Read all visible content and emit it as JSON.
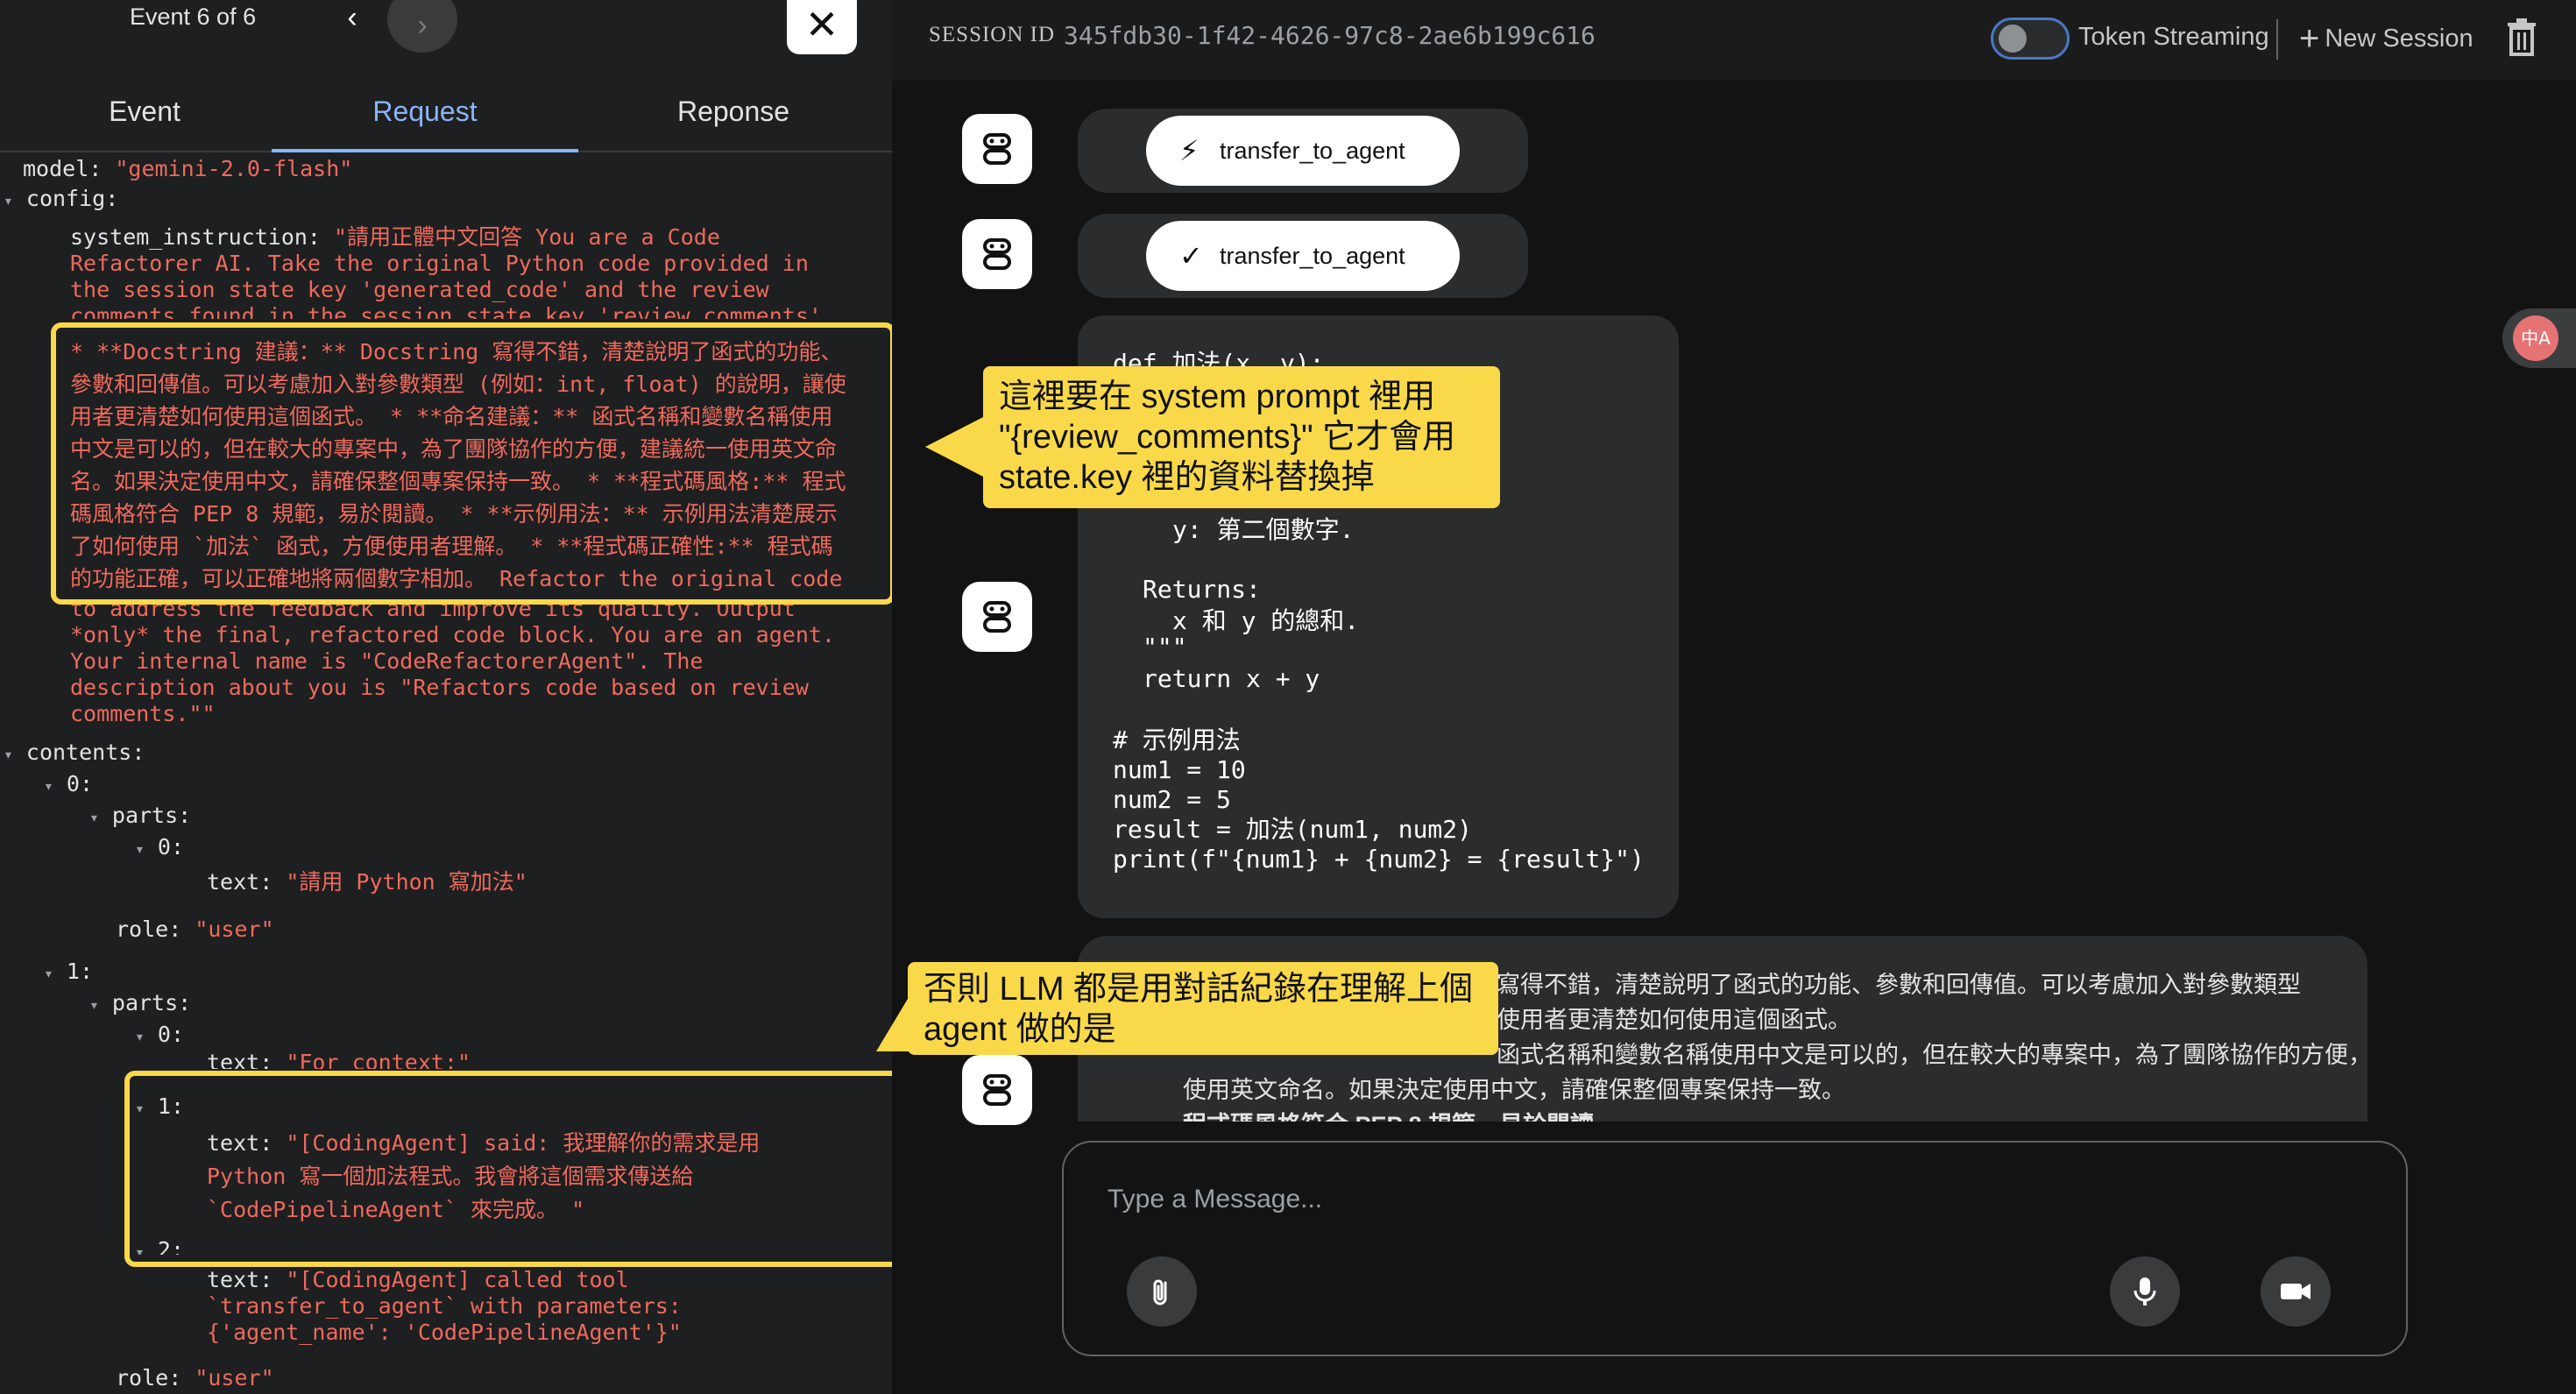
{
  "left_panel": {
    "event_counter": "Event 6 of 6",
    "prev_symbol": "‹",
    "next_symbol": "›",
    "close_symbol": "✕",
    "tabs": [
      {
        "label": "Event"
      },
      {
        "label": "Request"
      },
      {
        "label": "Reponse"
      }
    ],
    "active_tab": "Request",
    "code": {
      "model_key": "model:",
      "model_value": "\"gemini-2.0-flash\"",
      "config_key": "config:",
      "si_key": "system_instruction:",
      "si_line1": "\"請用正體中文回答 You are a Code",
      "si_line2": "Refactorer AI. Take the original Python code provided in",
      "si_line3": "the session state key 'generated_code' and the review",
      "si_line4": "comments found in the session state key 'review_comments'",
      "hl_line1": "* **Docstring 建議：** Docstring 寫得不錯，清楚說明了函式的功能、",
      "hl_line2": "參數和回傳值。可以考慮加入對參數類型 (例如：int, float) 的說明，讓使",
      "hl_line3": "用者更清楚如何使用這個函式。 * **命名建議：** 函式名稱和變數名稱使用",
      "hl_line4": "中文是可以的，但在較大的專案中，為了團隊協作的方便，建議統一使用英文命",
      "hl_line5": "名。如果決定使用中文，請確保整個專案保持一致。 * **程式碼風格:** 程式",
      "hl_line6": "碼風格符合 PEP 8 規範，易於閱讀。 * **示例用法：** 示例用法清楚展示",
      "hl_line7": "了如何使用 `加法` 函式，方便使用者理解。 * **程式碼正確性:** 程式碼",
      "hl_line8": "的功能正確，可以正確地將兩個數字相加。 Refactor the original code",
      "si_line5": "to address the feedback and improve its quality. Output",
      "si_line6": "*only* the final, refactored code block. You are an agent.",
      "si_line7": "Your internal name is \"CodeRefactorerAgent\". The",
      "si_line8": "description about you is \"Refactors code based on review",
      "si_line9": "comments.\"\"",
      "contents_key": "contents:",
      "idx0": "0:",
      "parts_key": "parts:",
      "text_key": "text:",
      "c0_text": "\"請用 Python 寫加法\"",
      "role_key": "role:",
      "role_value": "\"user\"",
      "idx1": "1:",
      "idx2": "2:",
      "c1_p0_text": "\"For context:\"",
      "c1_p1_line1": "\"[CodingAgent] said: 我理解你的需求是用",
      "c1_p1_line2": "Python 寫一個加法程式。我會將這個需求傳送給",
      "c1_p1_line3": "`CodePipelineAgent` 來完成。 \"",
      "c1_p2_line1": "\"[CodingAgent] called tool",
      "c1_p2_line2": "`transfer_to_agent` with parameters:",
      "c1_p2_line3": "{'agent_name': 'CodePipelineAgent'}\"",
      "twisty": "▾"
    }
  },
  "header": {
    "session_label": "SESSION ID",
    "session_id": "345fdb30-1f42-4626-97c8-2ae6b199c616",
    "token_streaming_label": "Token Streaming",
    "new_session_label": "New Session",
    "plus_symbol": "+"
  },
  "chat": {
    "function_call_label": "transfer_to_agent",
    "function_response_label": "transfer_to_agent",
    "call_icon": "bolt-icon",
    "response_icon": "check-icon",
    "code_lines": [
      "def 加法(x, y):",
      "y: 第二個數字.",
      "Returns:",
      "x 和 y 的總和.",
      "\"\"\"",
      "return x + y",
      "# 示例用法",
      "num1 = 10",
      "num2 = 5",
      "result = 加法(num1, num2)",
      "print(f\"{num1} + {num2} = {result}\")"
    ],
    "review_lines": [
      "寫得不錯，清楚說明了函式的功能、參數和回傳值。可以考慮加入對參數類型",
      "使用者更清楚如何使用這個函式。",
      "函式名稱和變數名稱使用中文是可以的，但在較大的專案中，為了團隊協作的方便，建議統一",
      "使用英文命名。如果決定使用中文，請確保整個專案保持一致。",
      "程式碼風格符合 PEP 8 規範，易於閱讀"
    ],
    "translate_label": "中A"
  },
  "input": {
    "placeholder": "Type a Message..."
  },
  "annotations": {
    "callout1": [
      "這裡要在 system prompt 裡用",
      "\"{review_comments}\" 它才會用",
      "state.key 裡的資料替換掉"
    ],
    "callout2": [
      "否則 LLM 都是用對話紀錄在理解上個",
      "agent 做的是"
    ]
  },
  "colors": {
    "highlight": "#f9d949",
    "string": "#ee6a5d",
    "active_tab": "#8ab4f8"
  }
}
